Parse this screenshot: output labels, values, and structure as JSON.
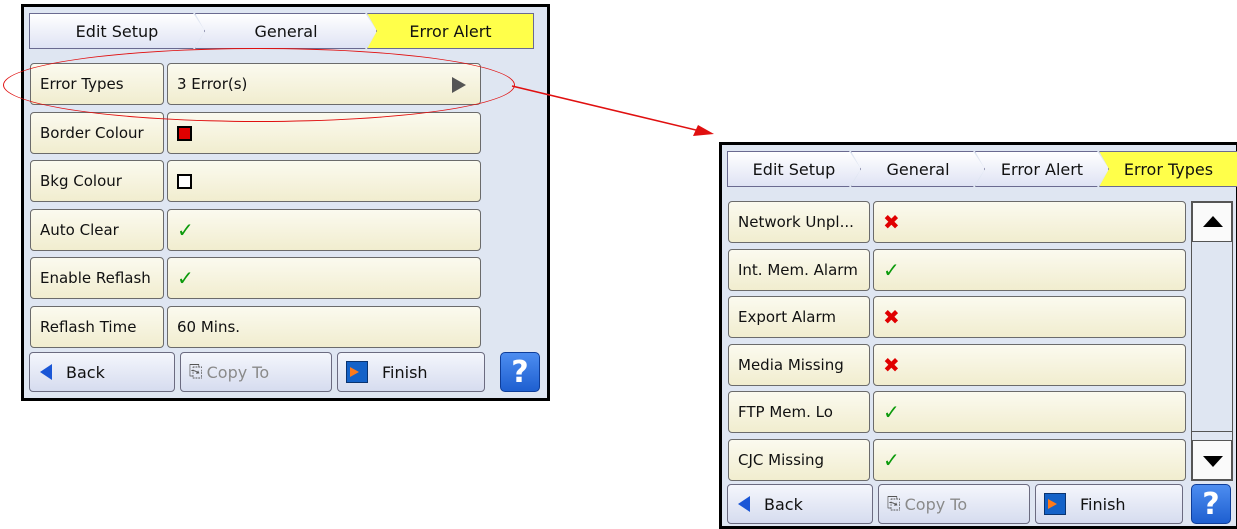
{
  "left": {
    "breadcrumbs": [
      "Edit Setup",
      "General",
      "Error Alert"
    ],
    "rows": [
      {
        "label": "Error Types",
        "value": "3 Error(s)",
        "kind": "text-arrow"
      },
      {
        "label": "Border Colour",
        "kind": "swatch",
        "swatch_color": "#e00000"
      },
      {
        "label": "Bkg Colour",
        "kind": "swatch",
        "swatch_color": "#ffffff"
      },
      {
        "label": "Auto Clear",
        "kind": "tick",
        "value": "✓"
      },
      {
        "label": "Enable Reflash",
        "kind": "tick",
        "value": "✓"
      },
      {
        "label": "Reflash Time",
        "value": "60 Mins.",
        "kind": "text"
      }
    ],
    "buttons": {
      "back": "Back",
      "copy_to": "Copy To",
      "finish": "Finish",
      "help": "?"
    }
  },
  "right": {
    "breadcrumbs": [
      "Edit Setup",
      "General",
      "Error Alert",
      "Error Types"
    ],
    "rows": [
      {
        "label": "Network Unpl...",
        "kind": "cross",
        "value": "✖"
      },
      {
        "label": "Int. Mem. Alarm",
        "kind": "tick",
        "value": "✓"
      },
      {
        "label": "Export Alarm",
        "kind": "cross",
        "value": "✖"
      },
      {
        "label": "Media Missing",
        "kind": "cross",
        "value": "✖"
      },
      {
        "label": "FTP Mem. Lo",
        "kind": "tick",
        "value": "✓"
      },
      {
        "label": "CJC Missing",
        "kind": "tick",
        "value": "✓"
      }
    ],
    "buttons": {
      "back": "Back",
      "copy_to": "Copy To",
      "finish": "Finish",
      "help": "?"
    }
  },
  "colors": {
    "active_crumb": "#ffff4a",
    "annotation": "#e01010",
    "tick": "#0b9a0b",
    "cross": "#e00000"
  }
}
